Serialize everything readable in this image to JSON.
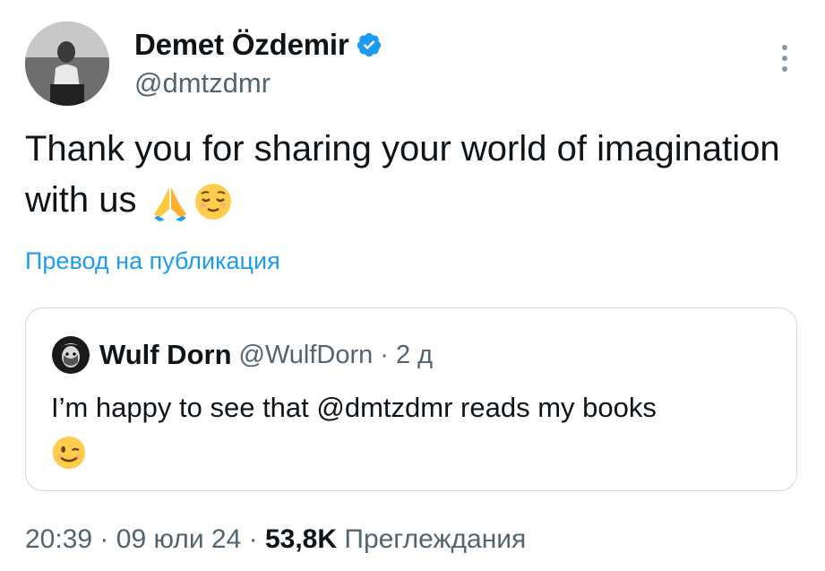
{
  "author": {
    "display_name": "Demet Özdemir",
    "handle": "@dmtzdmr",
    "verified": true
  },
  "tweet": {
    "text": "Thank you for sharing your world of imagination with us",
    "emojis": [
      "folded-hands",
      "relieved-face"
    ]
  },
  "translate_link": "Превод на публикация",
  "quoted_tweet": {
    "display_name": "Wulf Dorn",
    "handle": "@WulfDorn",
    "separator": "·",
    "time": "2 д",
    "text": "I’m happy to see that @dmtzdmr reads my books",
    "emoji": "winking-face"
  },
  "meta": {
    "time": "20:39",
    "sep1": "·",
    "date": "09 юли 24",
    "sep2": "·",
    "views_count": "53,8K",
    "views_label": "Преглеждания"
  },
  "colors": {
    "accent": "#1d9bf0",
    "text_primary": "#0f1419",
    "text_secondary": "#536471",
    "border": "#cfd9de"
  }
}
